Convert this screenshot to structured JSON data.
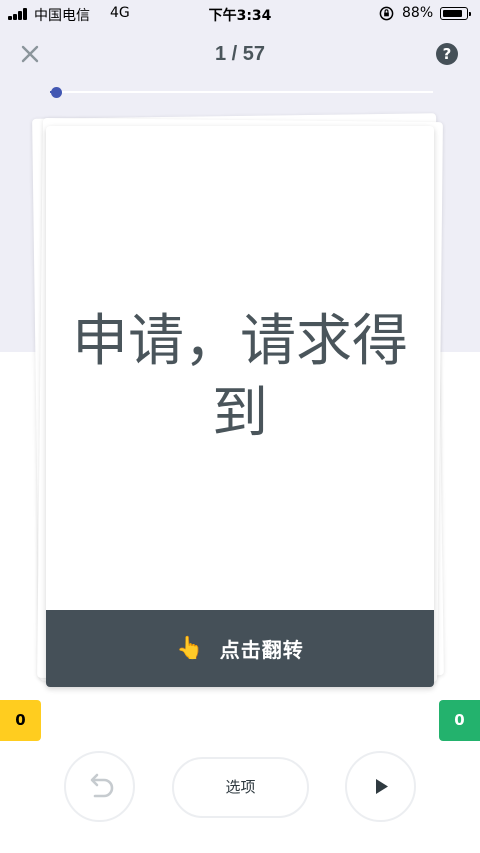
{
  "status_bar": {
    "carrier": "中国电信",
    "network": "4G",
    "time": "下午3:34",
    "battery_percent": "88%",
    "battery_level": 0.88
  },
  "header": {
    "close_icon": "close-icon",
    "counter": "1 / 57",
    "help_icon_text": "?",
    "progress": {
      "current": 1,
      "total": 57
    }
  },
  "card": {
    "term": "申请，请求得到",
    "flip_icon": "👆",
    "flip_label": "点击翻转"
  },
  "scores": {
    "left": "0",
    "right": "0",
    "left_color": "#ffcd1f",
    "right_color": "#23b26d"
  },
  "controls": {
    "undo_icon": "undo-icon",
    "options_label": "选项",
    "play_icon": "play-icon"
  },
  "colors": {
    "accent": "#4257b2",
    "card_bar": "#455058",
    "top_background": "#eeeef6"
  }
}
